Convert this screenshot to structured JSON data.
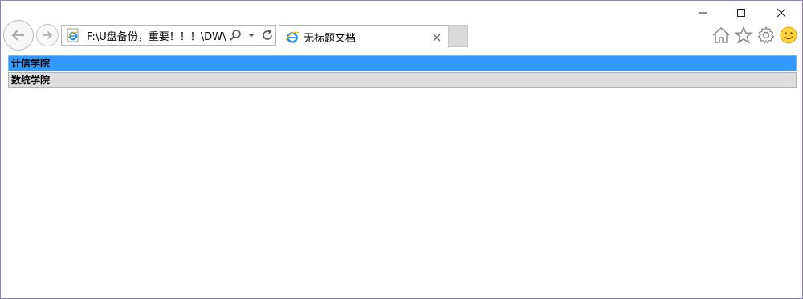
{
  "window": {
    "controls": {
      "minimize_icon": "minimize-icon",
      "maximize_icon": "maximize-icon",
      "close_icon": "close-icon"
    }
  },
  "navigation": {
    "back_icon": "back-arrow-icon",
    "forward_icon": "forward-arrow-icon"
  },
  "address_bar": {
    "url": "F:\\U盘备份，重要！！！\\DW\\",
    "search_icon": "search-icon",
    "dropdown_icon": "chevron-down-icon",
    "refresh_icon": "refresh-icon"
  },
  "tabs": [
    {
      "title": "无标题文档",
      "close_label": "×"
    }
  ],
  "toolbar": {
    "home_icon": "home-icon",
    "favorites_icon": "star-icon",
    "tools_icon": "gear-icon",
    "feedback_icon": "smiley-icon"
  },
  "page": {
    "colleges": [
      {
        "label": "计信学院",
        "state": "active"
      },
      {
        "label": "数统学院",
        "state": "inactive"
      }
    ]
  },
  "colors": {
    "active_row": "#3399ff",
    "inactive_row": "#dddddd",
    "window_border": "#8c7fc0"
  }
}
